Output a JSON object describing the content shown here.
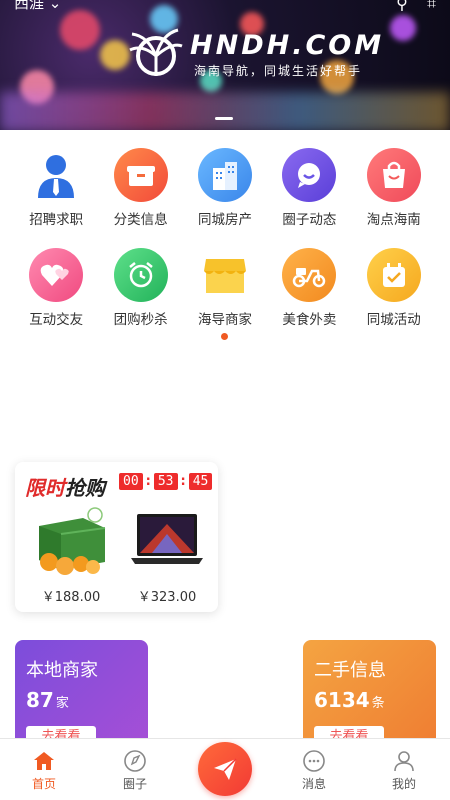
{
  "banner": {
    "location_text": "西涯",
    "logo_text": "HNDH.COM",
    "slogan": "海南导航，同城生活好帮手"
  },
  "grid": {
    "row1": [
      {
        "label": "招聘求职",
        "icon": "recruit-person-icon",
        "color": "#2f6fe0"
      },
      {
        "label": "分类信息",
        "icon": "category-box-icon",
        "color": "#f46b3c"
      },
      {
        "label": "同城房产",
        "icon": "building-icon",
        "color": "#4a9cf0"
      },
      {
        "label": "圈子动态",
        "icon": "chat-bubble-icon",
        "color": "#6a55e6"
      },
      {
        "label": "淘点海南",
        "icon": "shopping-bag-icon",
        "color": "#f35a5a"
      }
    ],
    "row2": [
      {
        "label": "互动交友",
        "icon": "hearts-icon",
        "color": "#f25c8a"
      },
      {
        "label": "团购秒杀",
        "icon": "alarm-clock-icon",
        "color": "#2ec16a"
      },
      {
        "label": "海导商家",
        "icon": "storefront-icon",
        "color": "#f7c22b"
      },
      {
        "label": "美食外卖",
        "icon": "scooter-icon",
        "color": "#f79b2b"
      },
      {
        "label": "同城活动",
        "icon": "gift-calendar-icon",
        "color": "#f7b52b"
      }
    ]
  },
  "flash_sale": {
    "title_red": "限时",
    "title_dark": "抢购",
    "countdown": {
      "h": "00",
      "m": "53",
      "s": "45"
    },
    "products": [
      {
        "name": "oranges-box",
        "price": "￥188.00"
      },
      {
        "name": "laptop",
        "price": "￥323.00"
      }
    ]
  },
  "cards": {
    "local_merchants": {
      "title": "本地商家",
      "count": "87",
      "unit": "家",
      "button": "去看看"
    },
    "second_hand": {
      "title": "二手信息",
      "count": "6134",
      "unit": "条",
      "button": "去看看"
    }
  },
  "tabbar": {
    "home": "首页",
    "circle": "圈子",
    "messages": "消息",
    "mine": "我的"
  },
  "colors": {
    "accent": "#f05a22",
    "purple_card": "#7c4ddb",
    "orange_card": "#f4a442"
  }
}
